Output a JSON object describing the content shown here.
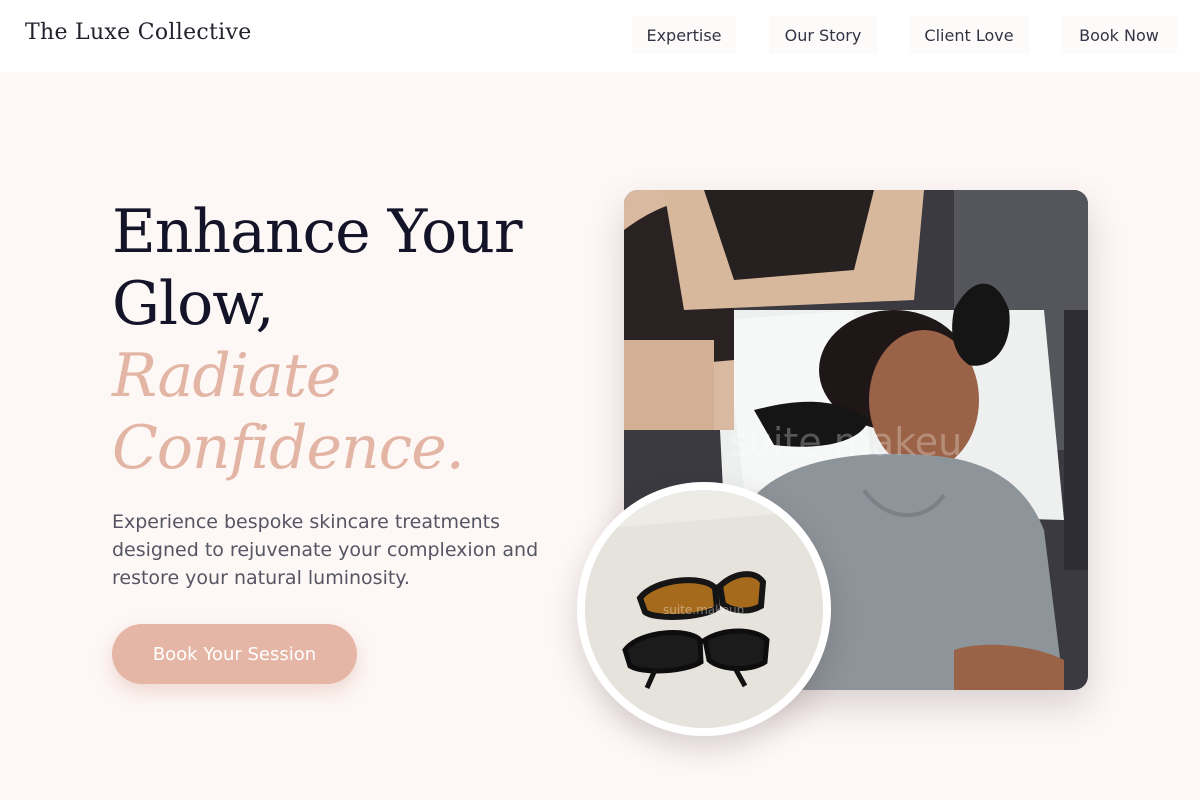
{
  "header": {
    "brand": "The Luxe Collective",
    "nav": [
      "Expertise",
      "Our Story",
      "Client Love",
      "Book Now"
    ]
  },
  "hero": {
    "headline_line1": "Enhance Your",
    "headline_line2": "Glow,",
    "headline_accent_line1": "Radiate",
    "headline_accent_line2": "Confidence.",
    "description": "Experience bespoke skincare treatments designed to rejuvenate your complexion and restore your natural luminosity.",
    "cta_label": "Book Your Session"
  },
  "images": {
    "main_watermark": "suite.makeu",
    "circle_watermark": "suite.makeup"
  },
  "colors": {
    "background": "#fdf7f6",
    "accent": "#e5b6a6",
    "headline": "#131428"
  }
}
